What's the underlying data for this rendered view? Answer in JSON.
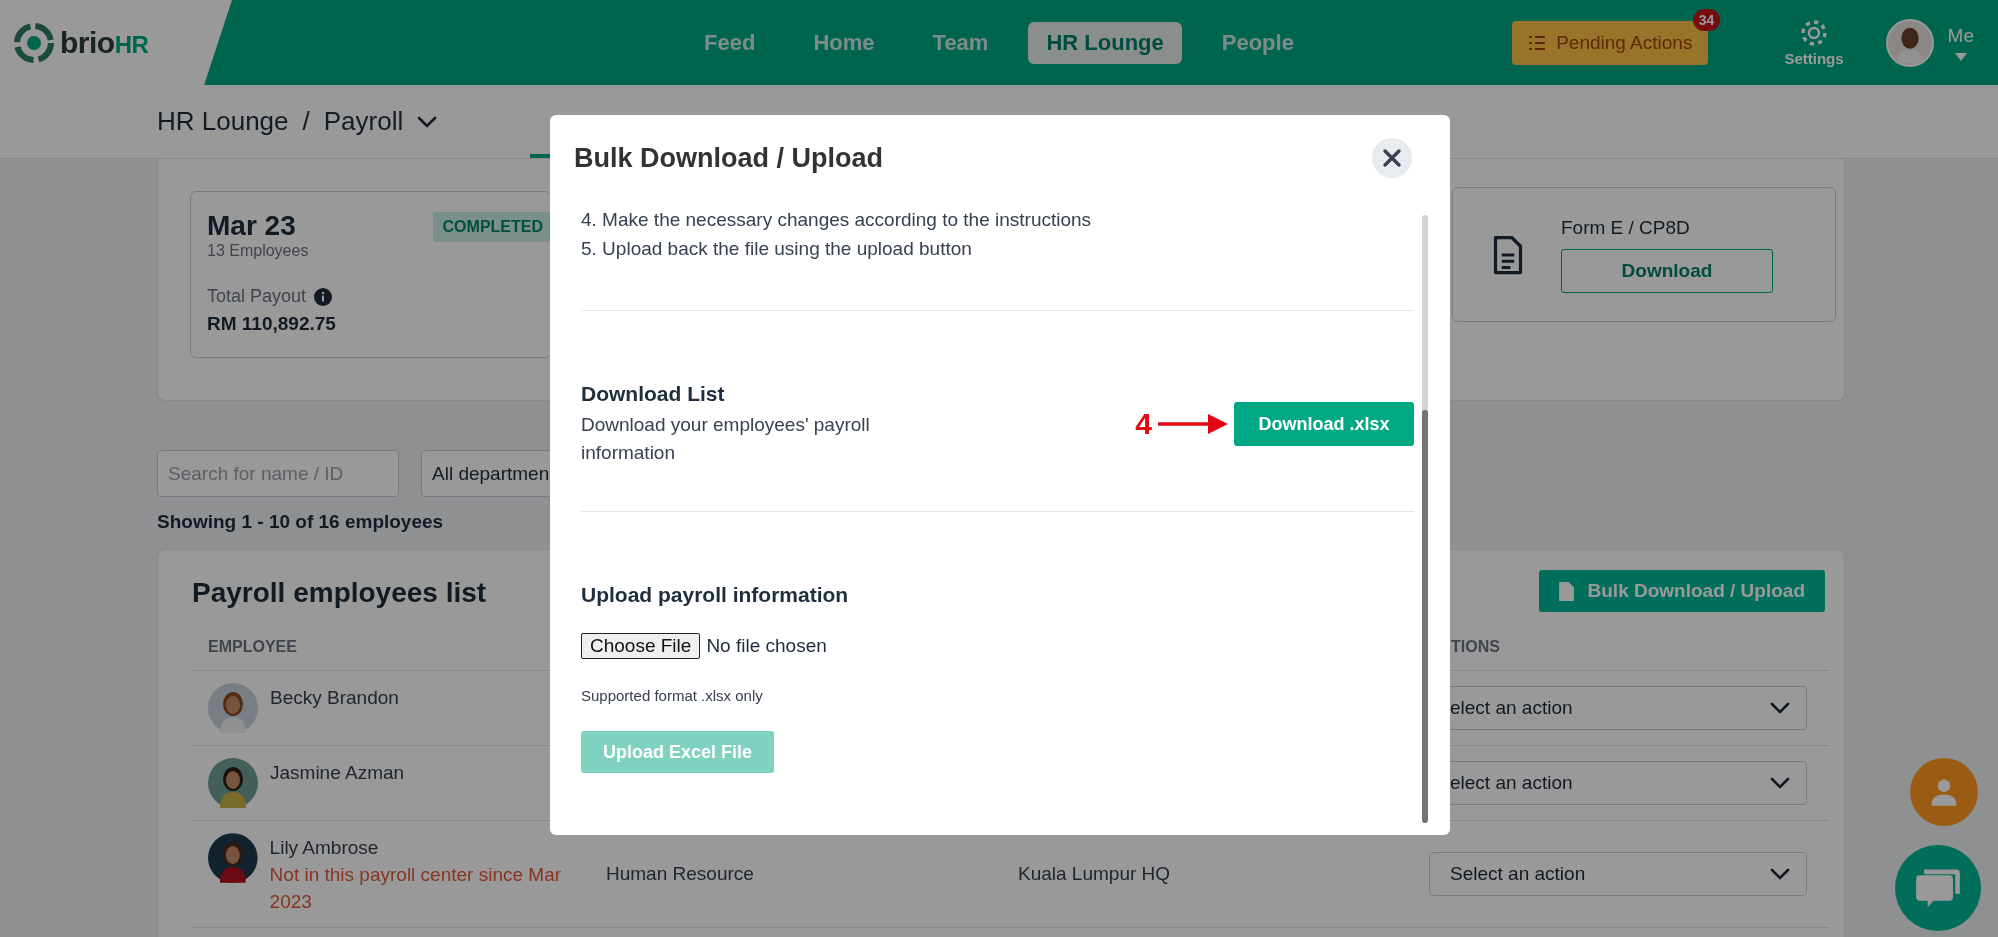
{
  "topbar": {
    "logo": {
      "name": "brio",
      "suffix": "HR"
    },
    "nav": [
      {
        "label": "Feed",
        "selected": false
      },
      {
        "label": "Home",
        "selected": false
      },
      {
        "label": "Team",
        "selected": false
      },
      {
        "label": "HR Lounge",
        "selected": true
      },
      {
        "label": "People",
        "selected": false
      }
    ],
    "pending_actions": {
      "label": "Pending Actions",
      "badge": "34"
    },
    "settings": "Settings",
    "profile": "Me"
  },
  "breadcrumb": {
    "section": "HR Lounge",
    "separator": "/",
    "page": "Payroll"
  },
  "payroll_card": {
    "period": "Mar 23",
    "employees": "13 Employees",
    "status": "COMPLETED",
    "total_label": "Total Payout",
    "total": "RM 110,892.75"
  },
  "forms_card": {
    "title": "Form E / CP8D",
    "button": "Download"
  },
  "filters": {
    "search": {
      "placeholder": "Search for name / ID"
    },
    "department": {
      "value": "All departmen"
    }
  },
  "showing": "Showing 1 - 10 of 16 employees",
  "employee_list": {
    "title": "Payroll employees list",
    "bulk_button": "Bulk Download / Upload",
    "columns": [
      "EMPLOYEE",
      "TIONS"
    ],
    "rows": [
      {
        "name": "Becky Brandon",
        "action": "elect an action"
      },
      {
        "name": "Jasmine Azman",
        "action": "elect an action"
      },
      {
        "name": "Lily Ambrose",
        "note": "Not in this payroll center since Mar 2023",
        "department": "Human Resource",
        "location": "Kuala Lumpur HQ",
        "action": "Select an action"
      }
    ]
  },
  "modal": {
    "title": "Bulk Download / Upload",
    "instructions": [
      "4. Make the necessary changes according to the instructions",
      "5. Upload back the file using the upload button"
    ],
    "download": {
      "title": "Download List",
      "description": "Download your employees' payroll information",
      "button": "Download .xlsx",
      "annotation": "4"
    },
    "upload": {
      "title": "Upload payroll information",
      "choose_button": "Choose File",
      "file_status": "No file chosen",
      "hint": "Supported format .xlsx only",
      "button": "Upload Excel File",
      "disabled": true
    }
  }
}
